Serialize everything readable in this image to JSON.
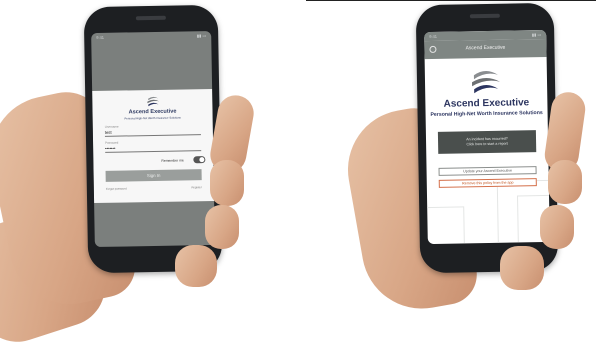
{
  "login_screen": {
    "status_time": "9:41",
    "brand_name": "Ascend Executive",
    "tagline": "Personal High-Net Worth Insurance Solutions",
    "username_label": "Username",
    "username_value": "test",
    "password_label": "Password",
    "password_value": "•••••••",
    "remember_label": "Remember me",
    "remember_on": true,
    "sign_in_label": "Sign In",
    "forgot_label": "Forgot password",
    "register_label": "Register"
  },
  "home_screen": {
    "status_time": "9:41",
    "header_title": "Ascend Executive",
    "brand_name": "Ascend Executive",
    "tagline": "Personal High-Net Worth Insurance Solutions",
    "report_line1": "An incident has occurred?",
    "report_line2": "Click here to start a report",
    "update_label": "Update your Ascend Executive",
    "remove_label": "Remove this policy from the app"
  },
  "colors": {
    "brand_navy": "#2c3560",
    "header_gray": "#7f8683",
    "remove_orange": "#c2541f"
  }
}
